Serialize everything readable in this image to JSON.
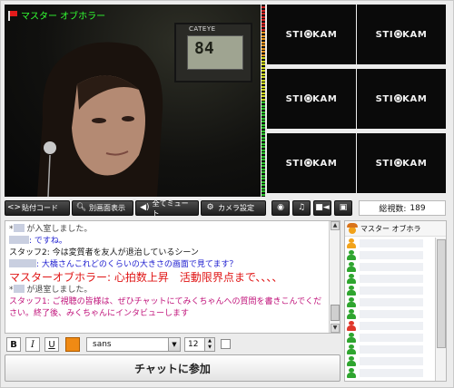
{
  "broadcaster": {
    "name": "マスター オブホラー"
  },
  "monitor": {
    "brand": "CATEYE",
    "reading": "84"
  },
  "tiles": [
    {
      "logo": "STICKAM"
    },
    {
      "logo": "STICKAM"
    },
    {
      "logo": "STICKAM"
    },
    {
      "logo": "STICKAM"
    },
    {
      "logo": "STICKAM"
    },
    {
      "logo": "STICKAM"
    }
  ],
  "controls": {
    "embed_code": "貼付コード",
    "popout": "別画面表示",
    "mute_all": "全てミュート",
    "camera_settings": "カメラ設定"
  },
  "view_count": {
    "label": "総視数:",
    "value": "189"
  },
  "chat": {
    "messages": [
      {
        "pre": "*",
        "ph": 12,
        "text": " が入室しました。",
        "color": "#444444",
        "size": 9
      },
      {
        "pre": "",
        "ph": 22,
        "text": ": ですね。",
        "color": "#1b1bcf",
        "size": 9
      },
      {
        "pre": "",
        "ph": 0,
        "text": "スタッフ2: 今は変質者を友人が退治しているシーン",
        "color": "#111111",
        "size": 9
      },
      {
        "pre": "",
        "ph": 30,
        "text": ": 大橋さんこれどのくらいの大きさの画面で見てます？",
        "color": "#1b1bcf",
        "size": 9
      },
      {
        "pre": "",
        "ph": 0,
        "text": "マスターオブホラー: 心拍数上昇　活動限界点まで、、、、",
        "color": "#e01616",
        "size": 12
      },
      {
        "pre": "*",
        "ph": 12,
        "text": " が退室しました。",
        "color": "#444444",
        "size": 9
      },
      {
        "pre": "",
        "ph": 0,
        "text": "スタッフ1: ご視聴の皆様は、ぜひチャットにてみくちゃんへの質問を書きこんでください。終了後、みくちゃんにインタビューします",
        "color": "#c0127a",
        "size": 9
      }
    ]
  },
  "format": {
    "bold": "B",
    "italic": "I",
    "underline": "U",
    "font": "sans",
    "size": "12"
  },
  "join_button": "チャットに参加",
  "user_list": {
    "host": "マスター オブホラ",
    "users": [
      {
        "color": "#f2a31b"
      },
      {
        "color": "#2fa52f"
      },
      {
        "color": "#2fa52f"
      },
      {
        "color": "#2fa52f"
      },
      {
        "color": "#2fa52f"
      },
      {
        "color": "#2fa52f"
      },
      {
        "color": "#2fa52f"
      },
      {
        "color": "#e0372b"
      },
      {
        "color": "#2fa52f"
      },
      {
        "color": "#2fa52f"
      },
      {
        "color": "#2fa52f"
      },
      {
        "color": "#2fa52f"
      }
    ]
  }
}
